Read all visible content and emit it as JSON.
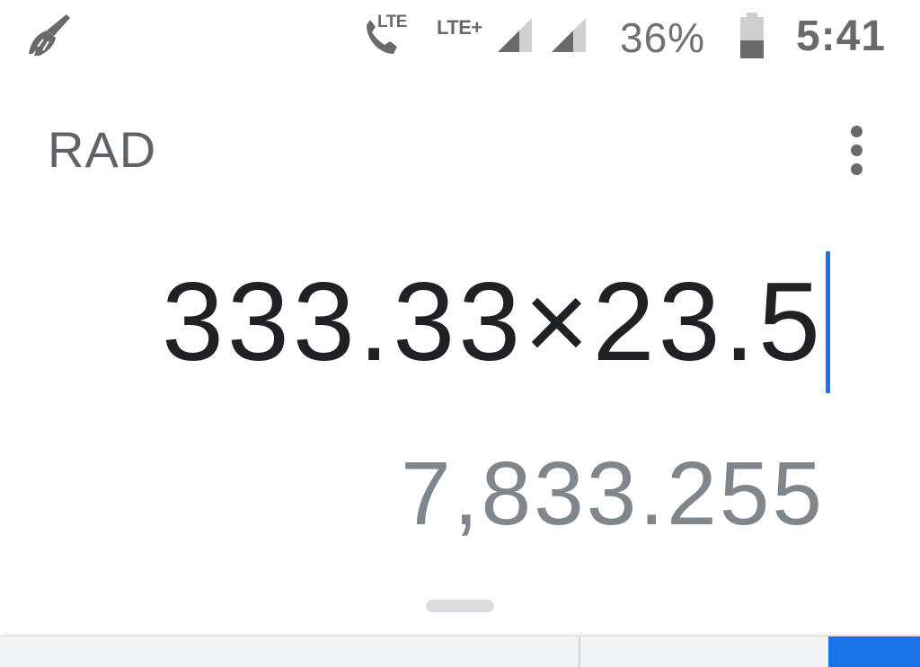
{
  "status_bar": {
    "icons": {
      "cleaner": "broom-icon",
      "call": "volte-call-icon",
      "signal_1": "signal-strength-icon",
      "signal_2": "signal-strength-icon",
      "battery": "battery-icon"
    },
    "call_lte_label": "LTE",
    "network_label": "LTE+",
    "battery_percent": "36%",
    "battery_level": 0.36,
    "time": "5:41"
  },
  "calculator": {
    "angle_mode": "RAD",
    "menu_icon": "more-vert-icon",
    "formula": "333.33×23.5",
    "result": "7,833.255"
  },
  "colors": {
    "accent": "#1a73e8",
    "formula_text": "#202124",
    "result_text": "#80868b",
    "status_icons": "#6a6a6a"
  }
}
